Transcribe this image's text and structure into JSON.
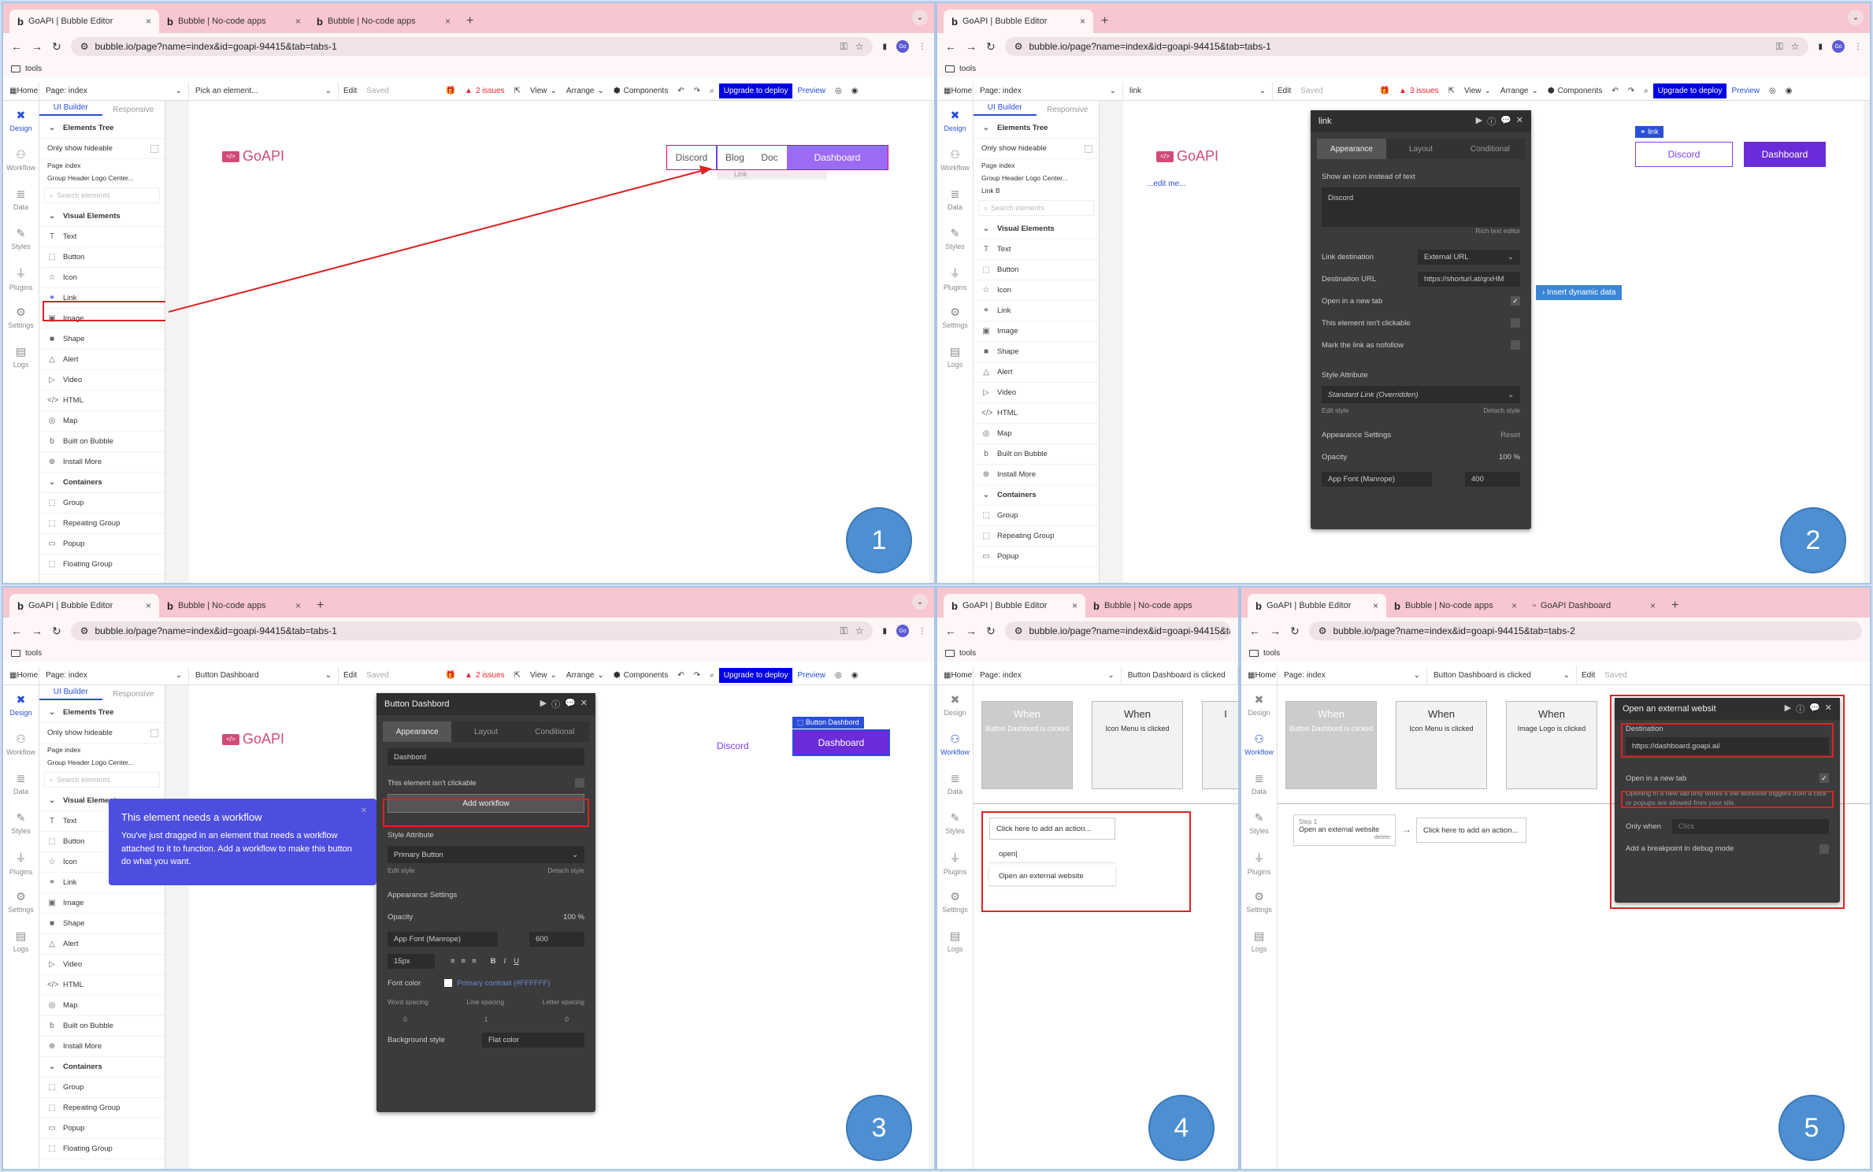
{
  "tabs_p1": [
    "GoAPI | Bubble Editor",
    "Bubble | No-code apps",
    "Bubble | No-code apps"
  ],
  "tabs_p2": [
    "GoAPI | Bubble Editor"
  ],
  "tabs_p3": [
    "GoAPI | Bubble Editor",
    "Bubble | No-code apps"
  ],
  "tabs_p4": [
    "GoAPI | Bubble Editor",
    "Bubble | No-code apps"
  ],
  "tabs_p5": [
    "GoAPI | Bubble Editor",
    "Bubble | No-code apps",
    "GoAPI Dashboard"
  ],
  "url_tabs1": "bubble.io/page?name=index&id=goapi-94415&tab=tabs-1",
  "url_tabs2": "bubble.io/page?name=index&id=goapi-94415&tab=tabs-2",
  "bookmark": "tools",
  "topbar": {
    "home": "Home",
    "page": "Page: index",
    "pick": "Pick an element...",
    "edit": "Edit",
    "saved": "Saved",
    "issues2": "2 issues",
    "issues3": "3 issues",
    "view": "View",
    "arrange": "Arrange",
    "components": "Components",
    "upgrade": "Upgrade to deploy",
    "preview": "Preview",
    "el_link": "link",
    "el_btn": "Button Dashboard",
    "el_clicked": "Button Dashboard is clicked"
  },
  "leftnav": [
    "Design",
    "Workflow",
    "Data",
    "Styles",
    "Plugins",
    "Settings",
    "Logs"
  ],
  "elements": {
    "tab_ui": "UI Builder",
    "tab_resp": "Responsive",
    "tree": "Elements Tree",
    "only": "Only show hideable",
    "page_index": "Page index",
    "group": "Group Header Logo Center...",
    "link_b": "Link B",
    "search": "Search elements",
    "visual": "Visual Elements",
    "items": [
      "Text",
      "Button",
      "Icon",
      "Link",
      "Image",
      "Shape",
      "Alert",
      "Video",
      "HTML",
      "Map",
      "Built on Bubble",
      "Install More"
    ],
    "containers": "Containers",
    "container_items": [
      "Group",
      "Repeating Group",
      "Popup",
      "Floating Group"
    ]
  },
  "canvas": {
    "logo": "GoAPI",
    "nav": [
      "Discord",
      "Blog",
      "Doc",
      "Dashboard"
    ],
    "link_ph": "Link",
    "edit_me": "...edit me...",
    "link_tag": "link",
    "btn_tag": "Button Dashbord"
  },
  "link_panel": {
    "title": "link",
    "tabs": [
      "Appearance",
      "Layout",
      "Conditional"
    ],
    "show_icon": "Show an icon instead of text",
    "text": "Discord",
    "rich": "Rich text editor",
    "dest_label": "Link destination",
    "dest_value": "External URL",
    "url_label": "Destination URL",
    "url_value": "https://shorturl.at/qrxHM",
    "insert": "Insert dynamic data",
    "new_tab": "Open in a new tab",
    "not_click": "This element isn't clickable",
    "nofollow": "Mark the link as nofollow",
    "style_attr": "Style Attribute",
    "style_value": "Standard Link (Overridden)",
    "edit_style": "Edit style",
    "detach": "Detach style",
    "app_settings": "Appearance Settings",
    "reset": "Reset",
    "opacity": "Opacity",
    "opacity_val": "100",
    "font": "App Font (Manrope)",
    "weight": "400"
  },
  "btn_panel": {
    "title": "Button Dashbord",
    "tabs": [
      "Appearance",
      "Layout",
      "Conditional"
    ],
    "text": "Dashbord",
    "not_click": "This element isn't clickable",
    "add_wf": "Add workflow",
    "style_attr": "Style Attribute",
    "style_value": "Primary Button",
    "edit_style": "Edit style",
    "detach": "Detach style",
    "app_settings": "Appearance Settings",
    "opacity": "Opacity",
    "opacity_val": "100",
    "font": "App Font (Manrope)",
    "weight": "600",
    "size": "15px",
    "font_color": "Font color",
    "color_val": "Primary contrast (#FFFFFF)",
    "word": "Word spacing",
    "line": "Line spacing",
    "letter": "Letter spacing",
    "word_val": "0",
    "line_val": "1",
    "letter_val": "0",
    "bg": "Background style",
    "bg_val": "Flat color"
  },
  "tooltip": {
    "title": "This element needs a workflow",
    "body": "You've just dragged in an element that needs a workflow attached to it to function. Add a workflow to make this button do what you want."
  },
  "wf": {
    "when": "When",
    "c1": "Button Dashbord is clicked",
    "c2": "Icon Menu is clicked",
    "c3": "Image Logo is clicked",
    "add_action": "Click here to add an action...",
    "typed": "open",
    "option": "Open an external website",
    "step": "Step 1",
    "step_name": "Open an external website",
    "delete": "delete"
  },
  "ext_panel": {
    "title": "Open an external websit",
    "dest": "Destination",
    "dest_val": "https://dashboard.goapi.ai/",
    "new_tab": "Open in a new tab",
    "note": "Opening in a new tab only works if the workflow triggers from a click or popups are allowed from your site.",
    "only_when": "Only when",
    "click_ph": "Click",
    "breakpoint": "Add a breakpoint in debug mode"
  },
  "steps": [
    "1",
    "2",
    "3",
    "4",
    "5"
  ]
}
